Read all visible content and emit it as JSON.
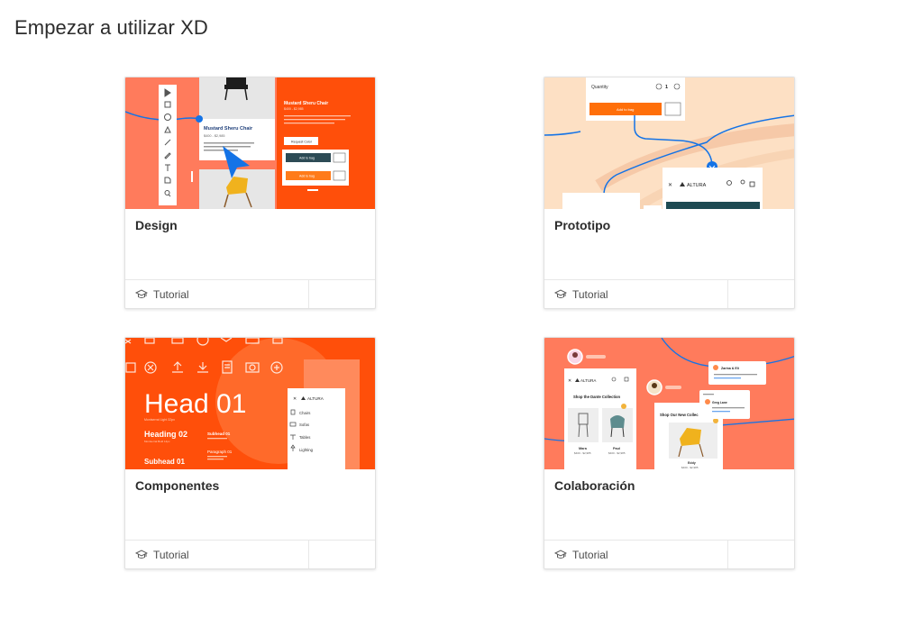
{
  "page": {
    "title": "Empezar a utilizar XD"
  },
  "cards": [
    {
      "title": "Design",
      "type_label": "Tutorial",
      "thumb": {
        "product_title": "Mustard Sheru Chair",
        "price": "$400 - $2,985",
        "button_add": "Add to bag",
        "button_request": "Request Color"
      }
    },
    {
      "title": "Prototipo",
      "type_label": "Tutorial",
      "thumb": {
        "quantity_label": "Quantity",
        "quantity_value": "1",
        "button_add": "Add to bag",
        "brand": "ALTURA"
      }
    },
    {
      "title": "Componentes",
      "type_label": "Tutorial",
      "thumb": {
        "head": "Head 01",
        "heading": "Heading 02",
        "subhead": "Subhead 01",
        "subhead2": "Subhead 01",
        "paragraph": "Paragraph 01",
        "brand": "ALTURA",
        "menu": [
          "Chairs",
          "Sofas",
          "Tables",
          "Lighting"
        ]
      }
    },
    {
      "title": "Colaboración",
      "type_label": "Tutorial",
      "thumb": {
        "brand": "ALTURA",
        "collection": "Shop the Dante Collection",
        "collection2": "Shop Our New Collec",
        "item1": "Mara",
        "item1_price": "$400 - $2,985",
        "item2": "Paul",
        "item2_price": "$400 - $2,985",
        "item3": "Eddy",
        "item3_price": "$400 - $2,985",
        "comment_user": "Zarina & Eli",
        "comment_user2": "Greg Lane"
      }
    }
  ],
  "colors": {
    "accent_orange": "#ff4f0a",
    "salmon": "#ff7b5c",
    "peach": "#fde0c4",
    "blue": "#1473e6"
  }
}
